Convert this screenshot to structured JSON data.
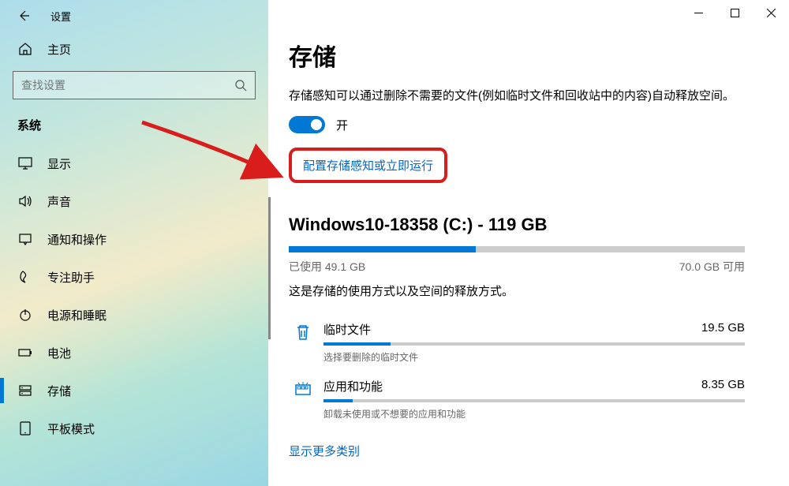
{
  "app_title": "设置",
  "home_label": "主页",
  "search_placeholder": "查找设置",
  "section_title": "系统",
  "nav": [
    {
      "label": "显示",
      "icon": "display"
    },
    {
      "label": "声音",
      "icon": "sound"
    },
    {
      "label": "通知和操作",
      "icon": "notification"
    },
    {
      "label": "专注助手",
      "icon": "focus"
    },
    {
      "label": "电源和睡眠",
      "icon": "power"
    },
    {
      "label": "电池",
      "icon": "battery"
    },
    {
      "label": "存储",
      "icon": "storage",
      "active": true
    },
    {
      "label": "平板模式",
      "icon": "tablet"
    }
  ],
  "page_title": "存储",
  "description": "存储感知可以通过删除不需要的文件(例如临时文件和回收站中的内容)自动释放空间。",
  "toggle_state": "开",
  "config_link": "配置存储感知或立即运行",
  "drive_title": "Windows10-18358 (C:) - 119 GB",
  "used_label": "已使用",
  "used_value": "49.1 GB",
  "free_value": "70.0 GB 可用",
  "progress_pct": 41,
  "usage_description": "这是存储的使用方式以及空间的释放方式。",
  "categories": [
    {
      "icon": "trash",
      "label": "临时文件",
      "size": "19.5 GB",
      "sub": "选择要删除的临时文件",
      "pct": 16
    },
    {
      "icon": "apps",
      "label": "应用和功能",
      "size": "8.35 GB",
      "sub": "卸载未使用或不想要的应用和功能",
      "pct": 7
    }
  ],
  "more_link": "显示更多类别"
}
